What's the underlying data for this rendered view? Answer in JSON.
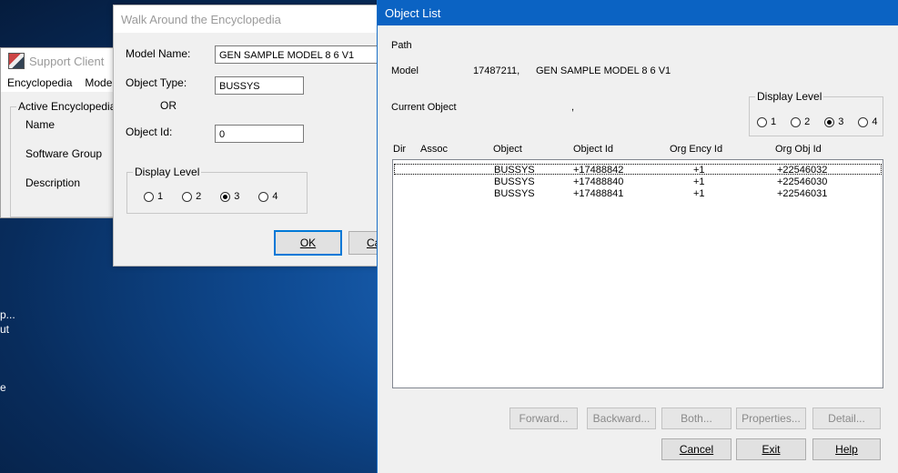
{
  "desktop": {
    "lines": [
      "p...",
      "ut",
      "e"
    ]
  },
  "support_client": {
    "title": "Support Client",
    "menu": [
      "Encyclopedia",
      "Model"
    ],
    "group_label": "Active Encyclopedia",
    "fields": [
      "Name",
      "Software Group",
      "Description"
    ]
  },
  "walk_dialog": {
    "title": "Walk Around the Encyclopedia",
    "model_name_label": "Model Name:",
    "model_name_value": "GEN SAMPLE MODEL 8 6 V1",
    "object_type_label": "Object Type:",
    "object_type_value": "BUSSYS",
    "or_label": "OR",
    "object_id_label": "Object Id:",
    "object_id_value": "0",
    "display_level_label": "Display Level",
    "levels": [
      "1",
      "2",
      "3",
      "4"
    ],
    "selected_level": "3",
    "ok_label": "OK",
    "cancel_partial": "Ca"
  },
  "object_list": {
    "title": "Object List",
    "path_label": "Path",
    "model_label": "Model",
    "model_id": "17487211,",
    "model_name": "GEN SAMPLE MODEL 8 6 V1",
    "current_object_label": "Current Object",
    "current_object_value": ",",
    "display_level_label": "Display Level",
    "levels": [
      "1",
      "2",
      "3",
      "4"
    ],
    "selected_level": "3",
    "columns": [
      "Dir",
      "Assoc",
      "Object",
      "Object Id",
      "Org Ency Id",
      "Org Obj Id"
    ],
    "rows": [
      {
        "object": "BUSSYS",
        "object_id": "+17488842",
        "org_ency_id": "+1",
        "org_obj_id": "+22546032"
      },
      {
        "object": "BUSSYS",
        "object_id": "+17488840",
        "org_ency_id": "+1",
        "org_obj_id": "+22546030"
      },
      {
        "object": "BUSSYS",
        "object_id": "+17488841",
        "org_ency_id": "+1",
        "org_obj_id": "+22546031"
      }
    ],
    "buttons": {
      "forward": "Forward...",
      "backward": "Backward...",
      "both": "Both...",
      "properties": "Properties...",
      "detail": "Detail...",
      "cancel": "Cancel",
      "exit": "Exit",
      "help": "Help"
    }
  }
}
